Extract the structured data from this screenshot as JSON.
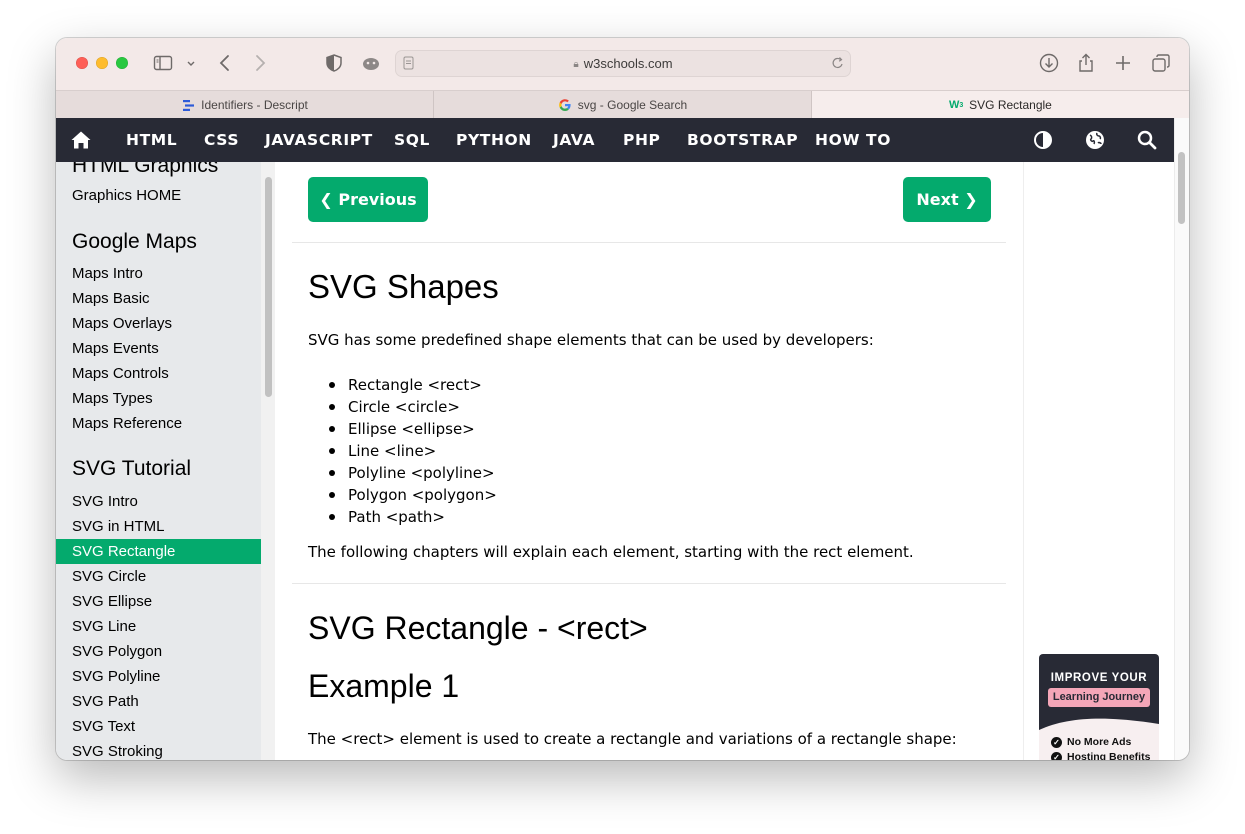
{
  "browser": {
    "url": "w3schools.com",
    "tabs": [
      {
        "label": "Identifiers - Descript",
        "icon": "descript-icon"
      },
      {
        "label": "svg - Google Search",
        "icon": "google-icon"
      },
      {
        "label": "SVG Rectangle",
        "icon": "w3schools-icon"
      }
    ],
    "active_tab": 2
  },
  "topnav": {
    "items": [
      "HTML",
      "CSS",
      "JAVASCRIPT",
      "SQL",
      "PYTHON",
      "JAVA",
      "PHP",
      "BOOTSTRAP",
      "HOW TO"
    ]
  },
  "sidebar": {
    "sections": [
      {
        "heading": "HTML Graphics",
        "links": [
          "Graphics HOME"
        ]
      },
      {
        "heading": "Google Maps",
        "links": [
          "Maps Intro",
          "Maps Basic",
          "Maps Overlays",
          "Maps Events",
          "Maps Controls",
          "Maps Types",
          "Maps Reference"
        ]
      },
      {
        "heading": "SVG Tutorial",
        "links": [
          "SVG Intro",
          "SVG in HTML",
          "SVG Rectangle",
          "SVG Circle",
          "SVG Ellipse",
          "SVG Line",
          "SVG Polygon",
          "SVG Polyline",
          "SVG Path",
          "SVG Text",
          "SVG Stroking"
        ]
      }
    ],
    "active_link": "SVG Rectangle"
  },
  "main": {
    "prev_label": "❮ Previous",
    "next_label": "Next ❯",
    "title": "SVG Shapes",
    "intro": "SVG has some predefined shape elements that can be used by developers:",
    "shapes": [
      "Rectangle <rect>",
      "Circle <circle>",
      "Ellipse <ellipse>",
      "Line <line>",
      "Polyline <polyline>",
      "Polygon <polygon>",
      "Path <path>"
    ],
    "chapters_note": "The following chapters will explain each element, starting with the rect element.",
    "section_title": "SVG Rectangle - <rect>",
    "example_title": "Example 1",
    "example_text": "The <rect> element is used to create a rectangle and variations of a rectangle shape:"
  },
  "ad": {
    "title": "IMPROVE YOUR",
    "pill": "Learning Journey",
    "features": [
      "No More Ads",
      "Hosting Benefits"
    ]
  },
  "colors": {
    "w3_green": "#04aa6d",
    "nav_dark": "#282a35",
    "sidebar_bg": "#e7e9eb"
  }
}
